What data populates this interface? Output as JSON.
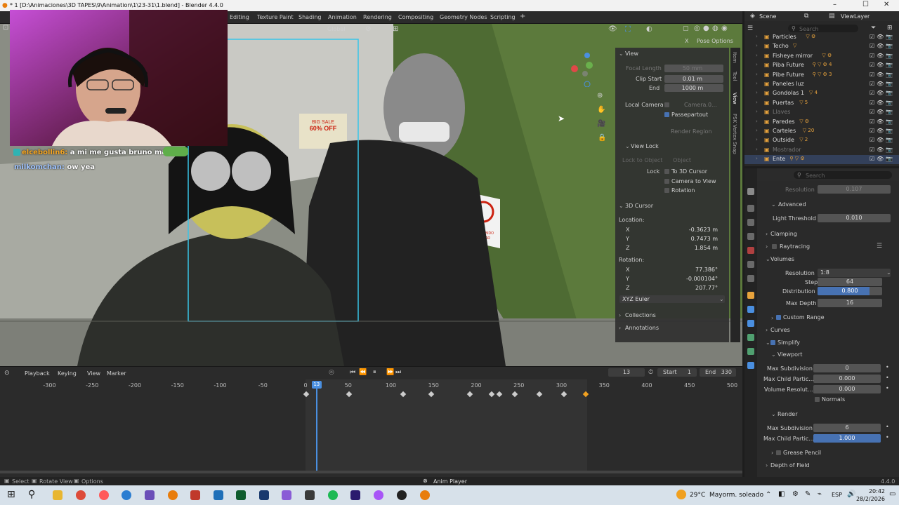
{
  "window": {
    "title": "* 1 [D:\\Animaciones\\3D TAPES\\9\\Animation\\1\\23-31\\1.blend] - Blender 4.4.0",
    "controls": [
      "–",
      "☐",
      "✕"
    ]
  },
  "workspaces": [
    "Editing",
    "Texture Paint",
    "Shading",
    "Animation",
    "Rendering",
    "Compositing",
    "Geometry Nodes",
    "Scripting",
    "+"
  ],
  "viewport_header": {
    "orientation": "Global",
    "pose_options": "Pose Options",
    "x_label": "X"
  },
  "chat": [
    {
      "user": "elcebollin6:",
      "message": "a mi me gusta bruno mars",
      "color": "#f5a623"
    },
    {
      "user": "milkomchan:",
      "message": "ow yea",
      "color": "#9fc4ff"
    }
  ],
  "scene_signs": {
    "sale_line1": "BIG SALE",
    "sale_line2": "60% OFF",
    "no_smoking_line1": "PROHIBIDO",
    "no_smoking_line2": "FUMAR"
  },
  "npanel": {
    "view_header": "View",
    "focal_length_label": "Focal Length",
    "focal_length": "50 mm",
    "clip_start_label": "Clip Start",
    "clip_start": "0.01 m",
    "end_label": "End",
    "end": "1000 m",
    "local_camera_label": "Local Camera",
    "local_camera_value": "Camera.0...",
    "passepartout": "Passepartout",
    "render_region": "Render Region",
    "view_lock_header": "View Lock",
    "lock_to_object": "Lock to Object",
    "object_placeholder": "Object",
    "lock_label": "Lock",
    "to_3d_cursor": "To 3D Cursor",
    "camera_to_view": "Camera to View",
    "rotation_option": "Rotation",
    "cursor_header": "3D Cursor",
    "location_label": "Location:",
    "loc_x": "-0.3623 m",
    "loc_y": "0.7473 m",
    "loc_z": "1.854 m",
    "rotation_label": "Rotation:",
    "rot_x": "77.386°",
    "rot_y": "-0.000104°",
    "rot_z": "207.77°",
    "rotation_mode": "XYZ Euler",
    "collections": "Collections",
    "annotations": "Annotations",
    "axis_x": "X",
    "axis_y": "Y",
    "axis_z": "Z"
  },
  "side_tabs": [
    "Item",
    "Tool",
    "View",
    "PSK Vertex Snap"
  ],
  "outliner": {
    "scene": "Scene",
    "view_layer": "ViewLayer",
    "search_placeholder": "Search",
    "items": [
      {
        "name": "Particles",
        "icons": "▽ ⚙"
      },
      {
        "name": "Techo",
        "icons": "▽"
      },
      {
        "name": "Fisheye mirror",
        "icons": "▽ ⚙"
      },
      {
        "name": "Piba Future",
        "icons": "⚲ ▽ ⚙ 4"
      },
      {
        "name": "Pibe Future",
        "icons": "⚲ ▽ ⚙ 3"
      },
      {
        "name": "Paneles luz",
        "icons": ""
      },
      {
        "name": "Gondolas 1",
        "icons": "▽ 4"
      },
      {
        "name": "Puertas",
        "icons": "▽ 5"
      },
      {
        "name": "Llaves",
        "icons": ""
      },
      {
        "name": "Paredes",
        "icons": "▽ ⚙"
      },
      {
        "name": "Carteles",
        "icons": "▽ 20"
      },
      {
        "name": "Outside",
        "icons": "▽ 2"
      },
      {
        "name": "Mostrador",
        "icons": ""
      },
      {
        "name": "Ente",
        "icons": "⚲ ▽ ⚙"
      }
    ]
  },
  "properties": {
    "search_placeholder": "Search",
    "resolution_top_label": "Resolution",
    "resolution_top": "0.107",
    "advanced": "Advanced",
    "light_threshold_label": "Light Threshold",
    "light_threshold": "0.010",
    "clamping": "Clamping",
    "raytracing": "Raytracing",
    "volumes": "Volumes",
    "resolution_label": "Resolution",
    "resolution": "1:8",
    "steps_label": "Steps",
    "steps": "64",
    "distribution_label": "Distribution",
    "distribution": "0.800",
    "distribution_fraction": 0.8,
    "max_depth_label": "Max Depth",
    "max_depth": "16",
    "custom_range": "Custom Range",
    "curves": "Curves",
    "simplify": "Simplify",
    "viewport": "Viewport",
    "max_subdivision_label": "Max Subdivision",
    "vp_max_subdivision": "0",
    "max_child_label": "Max Child Partic...",
    "vp_max_child": "0.000",
    "volume_res_label": "Volume Resolut...",
    "vp_volume_res": "0.000",
    "normals": "Normals",
    "render": "Render",
    "r_max_subdivision": "6",
    "r_max_child": "1.000",
    "r_max_child_fraction": 1.0,
    "grease_pencil": "Grease Pencil",
    "depth_of_field": "Depth of Field"
  },
  "timeline": {
    "menus": [
      "Playback",
      "Keying",
      "View",
      "Marker"
    ],
    "current_frame": "13",
    "start_label": "Start",
    "start": "1",
    "end_label": "End",
    "end": "330",
    "ruler": [
      "-300",
      "-250",
      "-200",
      "-150",
      "-100",
      "-50",
      "0",
      "50",
      "100",
      "150",
      "200",
      "250",
      "300",
      "350",
      "400",
      "450",
      "500"
    ],
    "keyframes": [
      1,
      51,
      114,
      147,
      193,
      218,
      227,
      245,
      274,
      303,
      328
    ]
  },
  "statusbar": {
    "select": "Select",
    "rotate_view": "Rotate View",
    "options": "Options",
    "anim_player": "Anim Player",
    "version": "4.4.0"
  },
  "taskbar": {
    "weather": "29°C",
    "weather_desc": "Mayorm. soleado",
    "lang": "ESP",
    "time": "20:42",
    "date": "28/2/2026"
  }
}
